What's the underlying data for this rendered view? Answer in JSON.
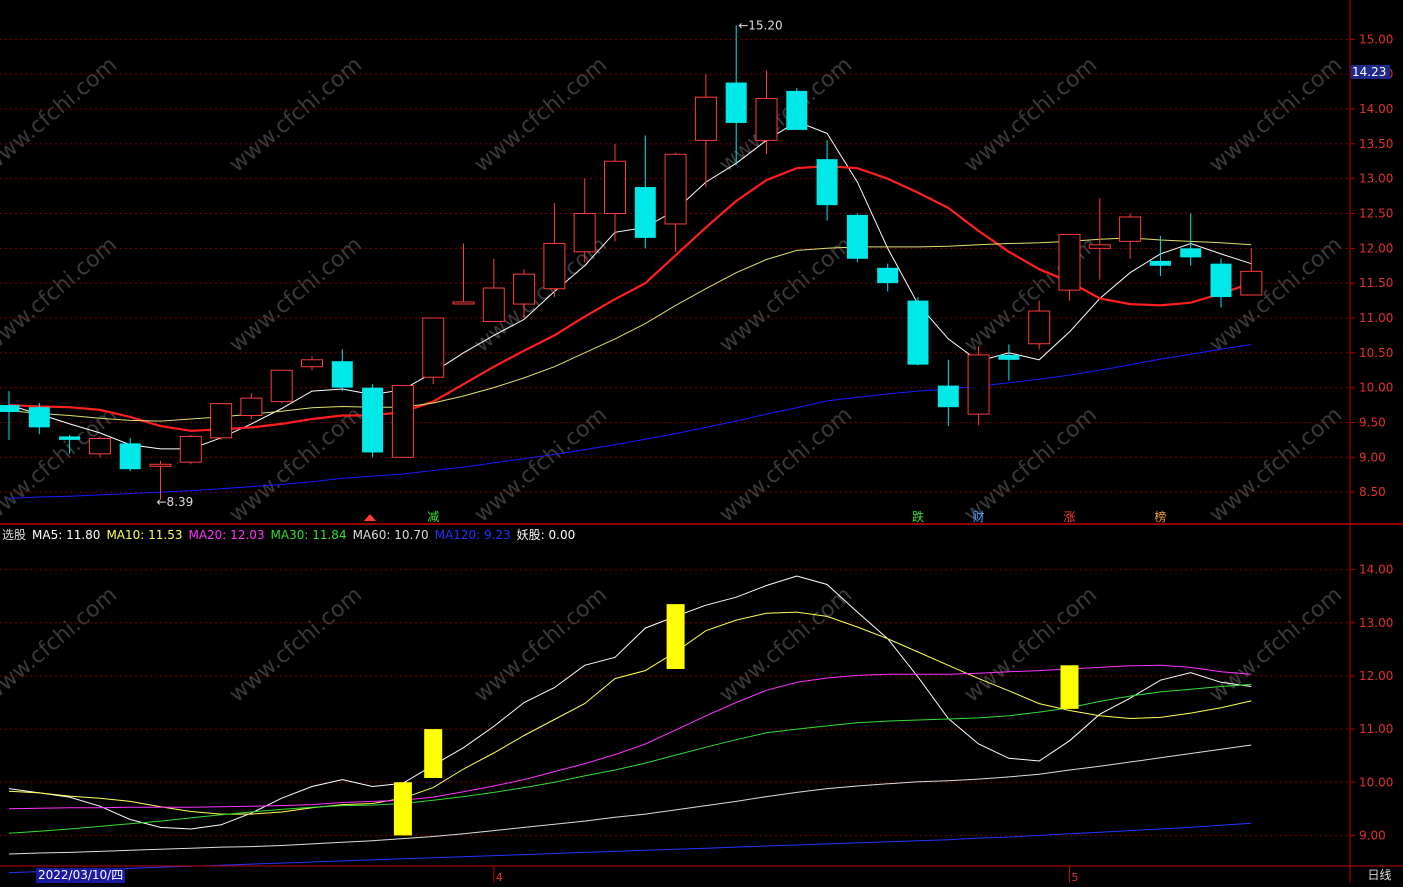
{
  "chart_data": [
    {
      "type": "candlestick",
      "panel": "main",
      "y_range": [
        8.1,
        15.45
      ],
      "y_ticks": [
        "15.00",
        "14.50",
        "14.00",
        "13.50",
        "13.00",
        "12.50",
        "12.00",
        "11.50",
        "11.00",
        "10.50",
        "10.00",
        "9.50",
        "9.00",
        "8.50"
      ],
      "current_price": "14.23",
      "max_marker": "15.20",
      "min_marker": "8.39",
      "candles": [
        {
          "o": 9.75,
          "h": 9.95,
          "l": 9.25,
          "c": 9.65,
          "up": false
        },
        {
          "o": 9.72,
          "h": 9.78,
          "l": 9.33,
          "c": 9.43,
          "up": false
        },
        {
          "o": 9.3,
          "h": 9.32,
          "l": 9.05,
          "c": 9.25,
          "up": false
        },
        {
          "o": 9.05,
          "h": 9.3,
          "l": 9.0,
          "c": 9.27,
          "up": true
        },
        {
          "o": 9.2,
          "h": 9.28,
          "l": 8.8,
          "c": 8.83,
          "up": false
        },
        {
          "o": 8.88,
          "h": 8.95,
          "l": 8.39,
          "c": 8.9,
          "up": true
        },
        {
          "o": 8.93,
          "h": 9.32,
          "l": 8.9,
          "c": 9.3,
          "up": true
        },
        {
          "o": 9.28,
          "h": 9.78,
          "l": 9.25,
          "c": 9.77,
          "up": true
        },
        {
          "o": 9.6,
          "h": 9.92,
          "l": 9.55,
          "c": 9.85,
          "up": true
        },
        {
          "o": 9.8,
          "h": 10.25,
          "l": 9.78,
          "c": 10.25,
          "up": true
        },
        {
          "o": 10.3,
          "h": 10.45,
          "l": 10.25,
          "c": 10.4,
          "up": true
        },
        {
          "o": 10.38,
          "h": 10.55,
          "l": 9.95,
          "c": 10.0,
          "up": false
        },
        {
          "o": 10.0,
          "h": 10.05,
          "l": 9.0,
          "c": 9.07,
          "up": false
        },
        {
          "o": 9.0,
          "h": 10.03,
          "l": 9.0,
          "c": 10.03,
          "up": true
        },
        {
          "o": 10.15,
          "h": 11.0,
          "l": 10.05,
          "c": 11.0,
          "up": true
        },
        {
          "o": 11.23,
          "h": 12.07,
          "l": 11.2,
          "c": 11.23,
          "up": true
        },
        {
          "o": 10.95,
          "h": 11.85,
          "l": 10.95,
          "c": 11.43,
          "up": true
        },
        {
          "o": 11.2,
          "h": 11.7,
          "l": 11.0,
          "c": 11.63,
          "up": true
        },
        {
          "o": 11.42,
          "h": 12.65,
          "l": 11.3,
          "c": 12.07,
          "up": true
        },
        {
          "o": 11.95,
          "h": 13.0,
          "l": 11.8,
          "c": 12.5,
          "up": true
        },
        {
          "o": 12.5,
          "h": 13.5,
          "l": 12.1,
          "c": 13.25,
          "up": true
        },
        {
          "o": 12.88,
          "h": 13.62,
          "l": 12.0,
          "c": 12.15,
          "up": false
        },
        {
          "o": 12.35,
          "h": 13.37,
          "l": 11.95,
          "c": 13.35,
          "up": true
        },
        {
          "o": 13.55,
          "h": 14.5,
          "l": 12.88,
          "c": 14.17,
          "up": true
        },
        {
          "o": 14.38,
          "h": 15.2,
          "l": 13.2,
          "c": 13.8,
          "up": false
        },
        {
          "o": 13.55,
          "h": 14.55,
          "l": 13.35,
          "c": 14.15,
          "up": true
        },
        {
          "o": 14.26,
          "h": 14.3,
          "l": 13.7,
          "c": 13.7,
          "up": false
        },
        {
          "o": 13.28,
          "h": 13.55,
          "l": 12.4,
          "c": 12.62,
          "up": false
        },
        {
          "o": 12.48,
          "h": 12.5,
          "l": 11.8,
          "c": 11.85,
          "up": false
        },
        {
          "o": 11.72,
          "h": 11.78,
          "l": 11.38,
          "c": 11.5,
          "up": false
        },
        {
          "o": 11.25,
          "h": 11.3,
          "l": 10.32,
          "c": 10.33,
          "up": false
        },
        {
          "o": 10.03,
          "h": 10.4,
          "l": 9.45,
          "c": 9.72,
          "up": false
        },
        {
          "o": 9.62,
          "h": 10.6,
          "l": 9.46,
          "c": 10.47,
          "up": true
        },
        {
          "o": 10.47,
          "h": 10.62,
          "l": 10.1,
          "c": 10.4,
          "up": false
        },
        {
          "o": 10.63,
          "h": 11.25,
          "l": 10.55,
          "c": 11.1,
          "up": true
        },
        {
          "o": 11.4,
          "h": 12.2,
          "l": 11.25,
          "c": 12.2,
          "up": true
        },
        {
          "o": 12.0,
          "h": 12.72,
          "l": 11.55,
          "c": 12.05,
          "up": true
        },
        {
          "o": 12.1,
          "h": 12.5,
          "l": 11.85,
          "c": 12.45,
          "up": true
        },
        {
          "o": 11.82,
          "h": 12.18,
          "l": 11.6,
          "c": 11.75,
          "up": false
        },
        {
          "o": 12.0,
          "h": 12.5,
          "l": 11.75,
          "c": 11.87,
          "up": false
        },
        {
          "o": 11.78,
          "h": 11.85,
          "l": 11.15,
          "c": 11.3,
          "up": false
        },
        {
          "o": 11.33,
          "h": 12.0,
          "l": 11.33,
          "c": 11.67,
          "up": true
        }
      ],
      "series": [
        {
          "color": "#ffffff",
          "values": [
            9.75,
            9.62,
            9.48,
            9.35,
            9.18,
            9.12,
            9.12,
            9.28,
            9.48,
            9.7,
            9.95,
            9.98,
            9.9,
            9.97,
            10.22,
            10.5,
            10.75,
            10.98,
            11.38,
            11.75,
            12.23,
            12.3,
            12.55,
            12.95,
            13.22,
            13.55,
            13.82,
            13.65,
            12.95,
            12.0,
            11.2,
            10.7,
            10.38,
            10.5,
            10.4,
            10.8,
            11.28,
            11.65,
            11.92,
            12.07,
            11.92,
            11.78
          ]
        },
        {
          "color": "#ff1f1f",
          "values": [
            9.75,
            9.73,
            9.72,
            9.68,
            9.58,
            9.45,
            9.38,
            9.4,
            9.43,
            9.48,
            9.55,
            9.6,
            9.6,
            9.65,
            9.8,
            10.05,
            10.3,
            10.53,
            10.75,
            11.02,
            11.27,
            11.5,
            11.9,
            12.3,
            12.68,
            12.98,
            13.15,
            13.18,
            13.15,
            13.0,
            12.8,
            12.58,
            12.25,
            11.95,
            11.7,
            11.52,
            11.28,
            11.2,
            11.18,
            11.22,
            11.35,
            11.5
          ]
        },
        {
          "color": "#e0e070",
          "values": [
            9.67,
            9.63,
            9.6,
            9.56,
            9.53,
            9.52,
            9.55,
            9.58,
            9.62,
            9.66,
            9.71,
            9.73,
            9.72,
            9.72,
            9.78,
            9.88,
            10.0,
            10.14,
            10.3,
            10.5,
            10.7,
            10.92,
            11.18,
            11.42,
            11.65,
            11.84,
            11.97,
            12.0,
            12.02,
            12.02,
            12.02,
            12.03,
            12.05,
            12.07,
            12.08,
            12.1,
            12.13,
            12.15,
            12.12,
            12.1,
            12.08,
            12.05
          ]
        },
        {
          "color": "#1a1aff",
          "values": [
            8.41,
            8.43,
            8.44,
            8.46,
            8.48,
            8.5,
            8.52,
            8.55,
            8.58,
            8.61,
            8.65,
            8.7,
            8.73,
            8.76,
            8.81,
            8.86,
            8.92,
            8.98,
            9.04,
            9.11,
            9.18,
            9.26,
            9.34,
            9.43,
            9.52,
            9.62,
            9.71,
            9.81,
            9.86,
            9.91,
            9.95,
            9.98,
            10.02,
            10.07,
            10.12,
            10.18,
            10.25,
            10.33,
            10.41,
            10.48,
            10.55,
            10.62
          ]
        }
      ],
      "markers": [
        {
          "text": "减",
          "color": "#3ce03c",
          "candle": 14
        },
        {
          "text": "跌",
          "color": "#3ce03c",
          "candle": 30
        },
        {
          "text": "财",
          "color": "#4aa0ff",
          "candle": 32
        },
        {
          "text": "涨",
          "color": "#ff3b3b",
          "candle": 35
        },
        {
          "text": "榜",
          "color": "#f0a030",
          "candle": 38
        }
      ]
    },
    {
      "type": "line",
      "panel": "indicator",
      "y_range": [
        8.5,
        14.5
      ],
      "y_ticks": [
        "14.00",
        "13.00",
        "12.00",
        "11.00",
        "10.00",
        "9.00"
      ],
      "series": [
        {
          "name": "MA5",
          "color": "#ffffff",
          "values": [
            9.88,
            9.8,
            9.72,
            9.55,
            9.3,
            9.15,
            9.12,
            9.2,
            9.42,
            9.7,
            9.92,
            10.05,
            9.92,
            9.98,
            10.32,
            10.65,
            11.05,
            11.5,
            11.78,
            12.2,
            12.35,
            12.9,
            13.12,
            13.33,
            13.48,
            13.7,
            13.88,
            13.72,
            13.2,
            12.7,
            11.98,
            11.2,
            10.72,
            10.45,
            10.4,
            10.78,
            11.28,
            11.58,
            11.92,
            12.06,
            11.88,
            11.8
          ]
        },
        {
          "name": "MA10",
          "color": "#ffff55",
          "values": [
            9.83,
            9.8,
            9.74,
            9.7,
            9.64,
            9.54,
            9.45,
            9.4,
            9.4,
            9.44,
            9.52,
            9.58,
            9.6,
            9.7,
            9.9,
            10.25,
            10.55,
            10.88,
            11.18,
            11.48,
            11.95,
            12.1,
            12.45,
            12.85,
            13.05,
            13.18,
            13.2,
            13.12,
            12.92,
            12.7,
            12.45,
            12.2,
            11.95,
            11.72,
            11.48,
            11.35,
            11.25,
            11.2,
            11.22,
            11.3,
            11.4,
            11.53
          ]
        },
        {
          "name": "MA20",
          "color": "#ff33ff",
          "values": [
            9.5,
            9.51,
            9.52,
            9.52,
            9.53,
            9.53,
            9.53,
            9.54,
            9.55,
            9.56,
            9.58,
            9.62,
            9.64,
            9.66,
            9.72,
            9.82,
            9.93,
            10.05,
            10.2,
            10.35,
            10.52,
            10.72,
            10.98,
            11.25,
            11.5,
            11.73,
            11.88,
            11.96,
            12.01,
            12.03,
            12.03,
            12.03,
            12.05,
            12.08,
            12.1,
            12.13,
            12.16,
            12.19,
            12.2,
            12.16,
            12.08,
            12.03
          ]
        },
        {
          "name": "MA30",
          "color": "#33dd33",
          "values": [
            9.04,
            9.08,
            9.12,
            9.17,
            9.22,
            9.27,
            9.33,
            9.39,
            9.44,
            9.49,
            9.53,
            9.56,
            9.57,
            9.6,
            9.66,
            9.73,
            9.81,
            9.9,
            10.0,
            10.12,
            10.23,
            10.36,
            10.51,
            10.66,
            10.8,
            10.93,
            11.0,
            11.06,
            11.12,
            11.15,
            11.17,
            11.19,
            11.21,
            11.25,
            11.32,
            11.4,
            11.52,
            11.62,
            11.7,
            11.75,
            11.8,
            11.84
          ]
        },
        {
          "name": "MA60",
          "color": "#dddddd",
          "values": [
            8.65,
            8.67,
            8.68,
            8.7,
            8.72,
            8.74,
            8.76,
            8.78,
            8.79,
            8.81,
            8.84,
            8.87,
            8.9,
            8.94,
            8.98,
            9.03,
            9.09,
            9.15,
            9.21,
            9.27,
            9.34,
            9.4,
            9.48,
            9.56,
            9.64,
            9.73,
            9.81,
            9.88,
            9.93,
            9.97,
            10.01,
            10.03,
            10.06,
            10.1,
            10.15,
            10.23,
            10.3,
            10.38,
            10.46,
            10.54,
            10.62,
            10.7
          ]
        },
        {
          "name": "MA120",
          "color": "#2233ff",
          "values": [
            8.3,
            8.32,
            8.34,
            8.36,
            8.38,
            8.4,
            8.42,
            8.44,
            8.46,
            8.48,
            8.5,
            8.52,
            8.54,
            8.56,
            8.58,
            8.6,
            8.62,
            8.64,
            8.66,
            8.68,
            8.7,
            8.72,
            8.74,
            8.76,
            8.78,
            8.8,
            8.82,
            8.84,
            8.86,
            8.88,
            8.9,
            8.92,
            8.95,
            8.97,
            9.0,
            9.03,
            9.06,
            9.09,
            9.12,
            9.15,
            9.19,
            9.23
          ]
        }
      ],
      "signal_bars": [
        {
          "candle": 13,
          "from": 9.0,
          "to": 10.0
        },
        {
          "candle": 14,
          "from": 10.08,
          "to": 11.0
        },
        {
          "candle": 22,
          "from": 12.13,
          "to": 13.35
        },
        {
          "candle": 35,
          "from": 11.38,
          "to": 12.2
        }
      ]
    }
  ],
  "legend": {
    "name": "选股",
    "items": [
      {
        "label": "MA5: 11.80",
        "color": "#ffffff"
      },
      {
        "label": "MA10: 11.53",
        "color": "#ffff55"
      },
      {
        "label": "MA20: 12.03",
        "color": "#ff33ff"
      },
      {
        "label": "MA30: 11.84",
        "color": "#33dd33"
      },
      {
        "label": "MA60: 10.70",
        "color": "#dddddd"
      },
      {
        "label": "MA120: 9.23",
        "color": "#2233ff"
      },
      {
        "label": "妖股: 0.00",
        "color": "#ffffff"
      }
    ]
  },
  "xaxis": {
    "date_label": "2022/03/10/四",
    "month_labels": [
      {
        "text": "4",
        "candle": 16
      },
      {
        "text": "5",
        "candle": 35
      }
    ],
    "period": "日线"
  },
  "watermark": "www.cfchi.com",
  "colors": {
    "up": "#ff3b3b",
    "down": "#00e8e8",
    "grid": "#7a0000",
    "axis": "#c00000"
  }
}
